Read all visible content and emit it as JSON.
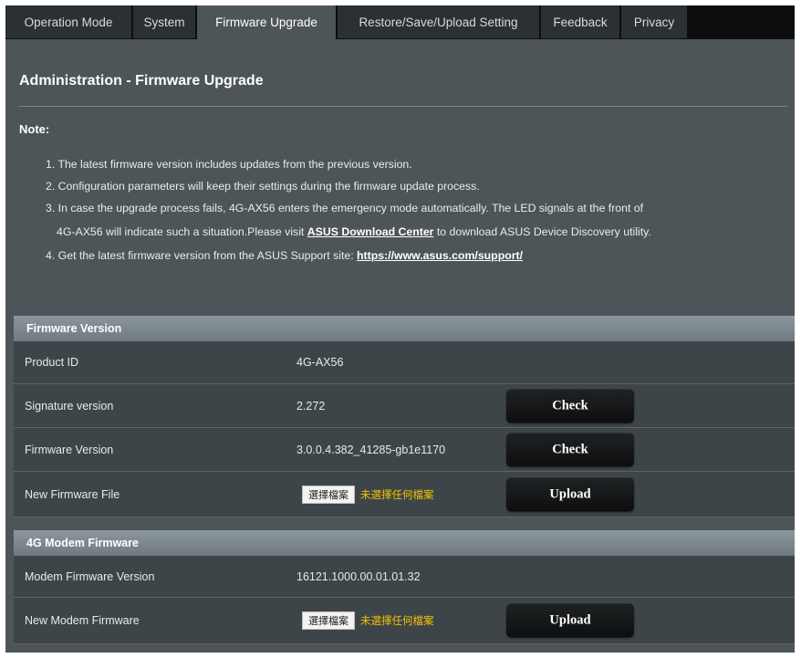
{
  "tabs": [
    {
      "label": "Operation Mode",
      "active": false
    },
    {
      "label": "System",
      "active": false
    },
    {
      "label": "Firmware Upgrade",
      "active": true
    },
    {
      "label": "Restore/Save/Upload Setting",
      "active": false
    },
    {
      "label": "Feedback",
      "active": false
    },
    {
      "label": "Privacy",
      "active": false
    }
  ],
  "page": {
    "title": "Administration - Firmware Upgrade",
    "note_label": "Note:"
  },
  "notes": {
    "item1": "1. The latest firmware version includes updates from the previous version.",
    "item2": "2. Configuration parameters will keep their settings during the firmware update process.",
    "item3_line1": "3. In case the upgrade process fails, 4G-AX56 enters the emergency mode automatically. The LED signals at the front of",
    "item3_line2_pre": "4G-AX56 will indicate such a situation.Please visit ",
    "item3_link": "ASUS Download Center",
    "item3_line2_post": " to download ASUS Device Discovery utility.",
    "item4_pre": "4. Get the latest firmware version from the ASUS Support site: ",
    "item4_link": "https://www.asus.com/support/"
  },
  "firmware_version": {
    "header": "Firmware Version",
    "product_id_label": "Product ID",
    "product_id_value": "4G-AX56",
    "signature_label": "Signature version",
    "signature_value": "2.272",
    "signature_button": "Check",
    "firmware_label": "Firmware Version",
    "firmware_value": "3.0.0.4.382_41285-gb1e1170",
    "firmware_button": "Check",
    "new_file_label": "New Firmware File",
    "choose_file_button": "選擇檔案",
    "no_file_text": "未選擇任何檔案",
    "upload_button": "Upload"
  },
  "modem_firmware": {
    "header": "4G Modem Firmware",
    "version_label": "Modem Firmware Version",
    "version_value": "16121.1000.00.01.01.32",
    "new_label": "New Modem Firmware",
    "choose_file_button": "選擇檔案",
    "no_file_text": "未選擇任何檔案",
    "upload_button": "Upload"
  }
}
